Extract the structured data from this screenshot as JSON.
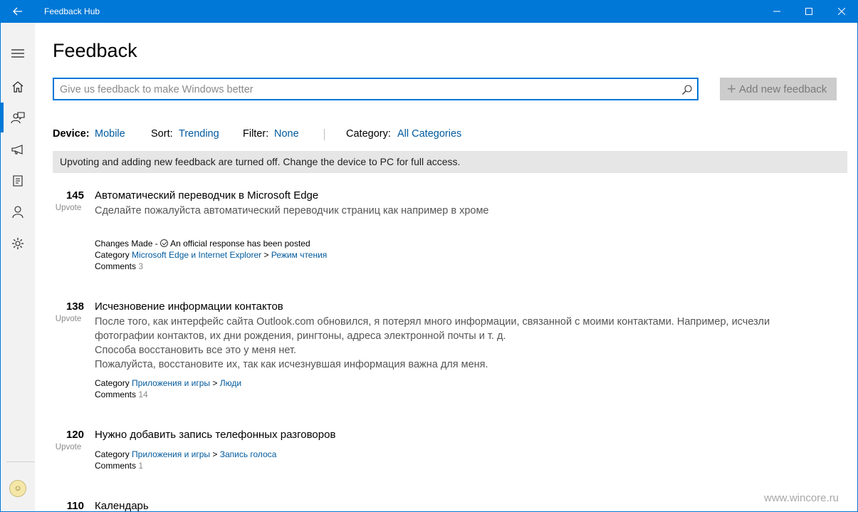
{
  "titlebar": {
    "title": "Feedback Hub"
  },
  "page": {
    "title": "Feedback"
  },
  "search": {
    "placeholder": "Give us feedback to make Windows better"
  },
  "add_button": {
    "label": "Add new feedback"
  },
  "filters": {
    "device_label": "Device:",
    "device_value": "Mobile",
    "sort_label": "Sort:",
    "sort_value": "Trending",
    "filter_label": "Filter:",
    "filter_value": "None",
    "category_label": "Category:",
    "category_value": "All Categories"
  },
  "banner": {
    "text": "Upvoting and adding new feedback are turned off. Change the device to PC for full access."
  },
  "items": [
    {
      "votes": "145",
      "upvote": "Upvote",
      "title": "Автоматический переводчик в  Microsoft Edge",
      "desc": "Сделайте пожалуйста автоматический переводчик страниц как например в хроме",
      "status": "Changes Made",
      "status_sep": " - ",
      "response": "An official response has been posted",
      "category_label": "Category",
      "category": "Microsoft Edge и Internet Explorer",
      "category_sep": " > ",
      "subcategory": "Режим чтения",
      "comments_label": "Comments",
      "comments": "3"
    },
    {
      "votes": "138",
      "upvote": "Upvote",
      "title": "Исчезновение информации контактов",
      "desc_lines": [
        "После того, как интерфейс сайта Outlook.com обновился, я потерял много информации, связанной с моими контактами. Например, исчезли",
        "фотографии контактов, их дни рождения, рингтоны, адреса электронной почты и т. д.",
        "Способа восстановить все это у меня нет.",
        "Пожалуйста, восстановите их, так как исчезнувшая информация важна для меня."
      ],
      "category_label": "Category",
      "category": "Приложения и игры",
      "category_sep": " > ",
      "subcategory": "Люди",
      "comments_label": "Comments",
      "comments": "14"
    },
    {
      "votes": "120",
      "upvote": "Upvote",
      "title": "Нужно добавить запись телефонных разговоров",
      "category_label": "Category",
      "category": "Приложения и игры",
      "category_sep": " > ",
      "subcategory": "Запись голоса",
      "comments_label": "Comments",
      "comments": "1"
    },
    {
      "votes": "110",
      "title": "Календарь"
    }
  ],
  "watermark": "www.wincore.ru",
  "colors": {
    "accent": "#0078d7",
    "link": "#005a9e",
    "banner_bg": "#e6e6e6"
  }
}
